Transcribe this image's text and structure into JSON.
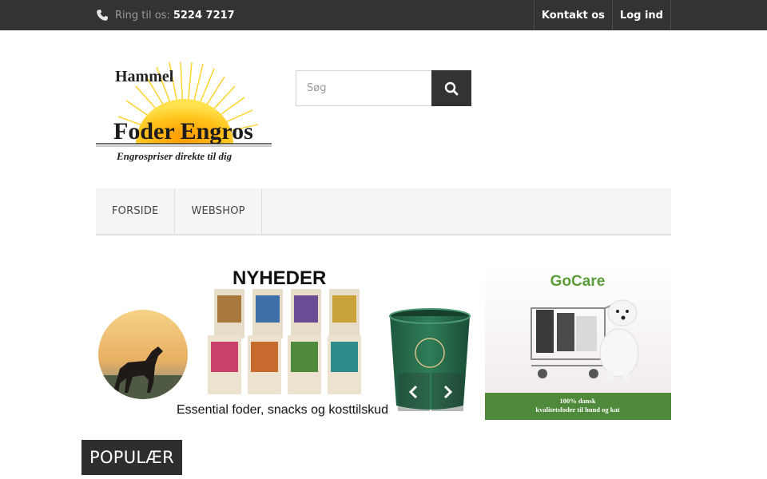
{
  "topbar": {
    "phone_label": "Ring til os:",
    "phone_number": "5224 7217",
    "links": [
      "Kontakt os",
      "Log ind"
    ]
  },
  "logo": {
    "line1": "Hammel",
    "line2": "Foder Engros",
    "tagline": "Engrospriser direkte til dig"
  },
  "search": {
    "placeholder": "Søg"
  },
  "nav": {
    "items": [
      "FORSIDE",
      "WEBSHOP"
    ]
  },
  "banner": {
    "heading": "NYHEDER",
    "caption": "Essential foder, snacks og kosttilskud"
  },
  "promo": {
    "title": "GoCare",
    "line1": "100% dansk",
    "line2": "kvalitetsfoder til hund og kat"
  },
  "section": {
    "popular": "POPULÆR"
  },
  "colors": {
    "topbar": "#333333",
    "nav_bg": "#f5f5f5",
    "promo_green": "#4e8a3a",
    "section_badge": "#2e2e2e"
  },
  "icons": [
    "phone-icon",
    "search-icon",
    "chevron-left-icon",
    "chevron-right-icon"
  ]
}
